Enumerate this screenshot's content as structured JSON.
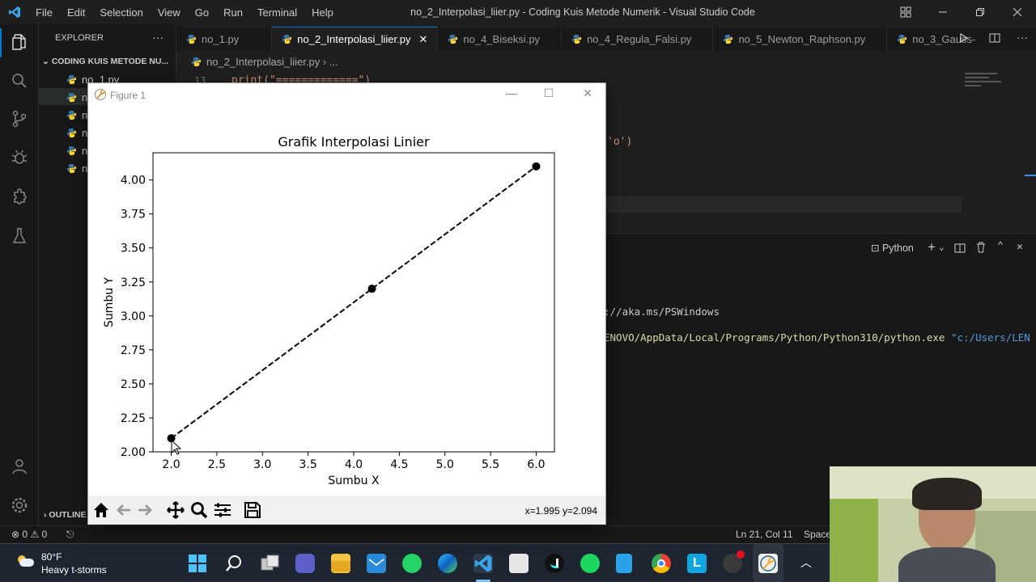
{
  "titlebar": {
    "menu": [
      "File",
      "Edit",
      "Selection",
      "View",
      "Go",
      "Run",
      "Terminal",
      "Help"
    ],
    "window_title": "no_2_Interpolasi_liier.py - Coding Kuis Metode Numerik - Visual Studio Code"
  },
  "sidebar": {
    "header": "EXPLORER",
    "folder": "CODING KUIS METODE NU...",
    "files": [
      "no_1.py",
      "n",
      "n",
      "n",
      "n",
      "n"
    ],
    "outline": "OUTLINE"
  },
  "tabs": [
    {
      "label": "no_1.py",
      "active": false
    },
    {
      "label": "no_2_Interpolasi_liier.py",
      "active": true
    },
    {
      "label": "no_4_Biseksi.py",
      "active": false
    },
    {
      "label": "no_4_Regula_Falsi.py",
      "active": false
    },
    {
      "label": "no_5_Newton_Raphson.py",
      "active": false
    },
    {
      "label": "no_3_Gauss-",
      "active": false
    }
  ],
  "breadcrumb": {
    "file": "no_2_Interpolasi_liier.py",
    "rest": "..."
  },
  "editor": {
    "line_number": "13",
    "line_code": "print(\"=============\")",
    "partial_code": "'o')"
  },
  "panel": {
    "terminal_name": "Python",
    "line1": "://aka.ms/PSWindows",
    "line2_path": "ENOVO/AppData/Local/Programs/Python/Python310/python.exe",
    "line2_arg": "\"c:/Users/LEN"
  },
  "statusbar": {
    "errors": "0",
    "warnings": "0",
    "position": "Ln 21, Col 11",
    "spaces": "Space"
  },
  "taskbar": {
    "weather_temp": "80°F",
    "weather_desc": "Heavy t-storms"
  },
  "figure": {
    "window_title": "Figure 1",
    "coord_readout": "x=1.995 y=2.094"
  },
  "chart_data": {
    "type": "line",
    "title": "Grafik Interpolasi Linier",
    "xlabel": "Sumbu X",
    "ylabel": "Sumbu Y",
    "x": [
      2.0,
      4.2,
      6.0
    ],
    "y": [
      2.1,
      3.2,
      4.1
    ],
    "xlim": [
      1.8,
      6.2
    ],
    "ylim": [
      2.0,
      4.2
    ],
    "xticks": [
      "2.0",
      "2.5",
      "3.0",
      "3.5",
      "4.0",
      "4.5",
      "5.0",
      "5.5",
      "6.0"
    ],
    "yticks": [
      "2.00",
      "2.25",
      "2.50",
      "2.75",
      "3.00",
      "3.25",
      "3.50",
      "3.75",
      "4.00"
    ],
    "line_style": "dashed",
    "marker": "o",
    "color": "#000000",
    "grid": false
  }
}
